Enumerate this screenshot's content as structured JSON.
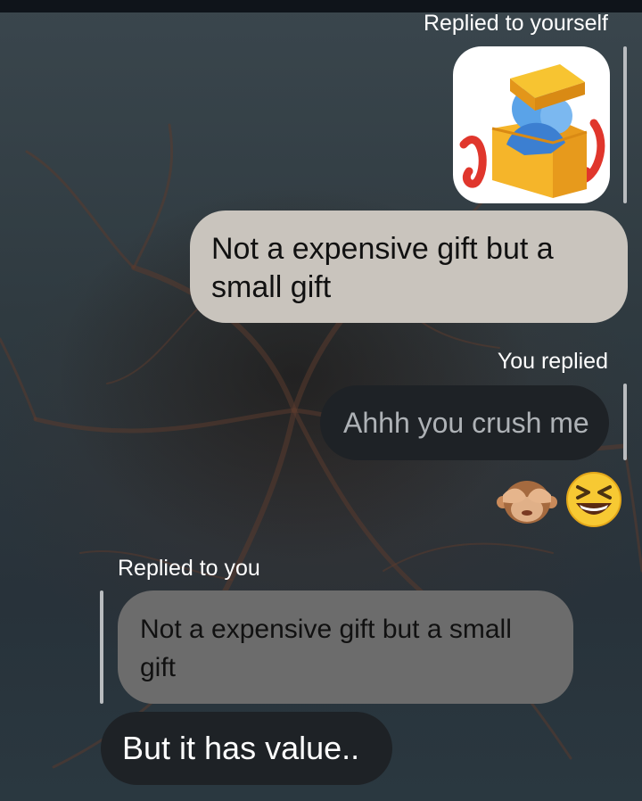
{
  "messages": [
    {
      "reply_label": "Replied to yourself",
      "sticker": "gift-box-hug-icon"
    },
    {
      "text": "Not a expensive gift but a small gift"
    },
    {
      "reply_label": "You replied",
      "text": "Ahhh you crush me"
    },
    {
      "reactions": [
        "see-no-evil-monkey-icon",
        "grinning-squinting-face-icon"
      ]
    },
    {
      "reply_label": "Replied to you",
      "quoted_text": "Not a expensive gift but a small gift"
    },
    {
      "text": "But it has value.."
    }
  ],
  "colors": {
    "light_bubble": "#c9c4bd",
    "dark_bubble": "#1e2226",
    "quoted_bubble": "#6c6c6c"
  }
}
